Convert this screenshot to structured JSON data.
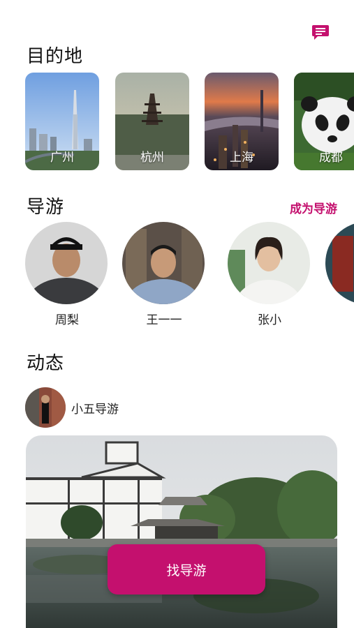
{
  "header": {
    "message_icon": "chat-bubble-icon",
    "accent": "#c4106e"
  },
  "destinations": {
    "title": "目的地",
    "items": [
      {
        "label": "广州"
      },
      {
        "label": "杭州"
      },
      {
        "label": "上海"
      },
      {
        "label": "成都"
      }
    ]
  },
  "guides": {
    "title": "导游",
    "become_label": "成为导游",
    "items": [
      {
        "name": "周梨"
      },
      {
        "name": "王一一"
      },
      {
        "name": "张小"
      }
    ]
  },
  "feed": {
    "title": "动态",
    "poster_name": "小五导游",
    "cta_label": "找导游"
  }
}
